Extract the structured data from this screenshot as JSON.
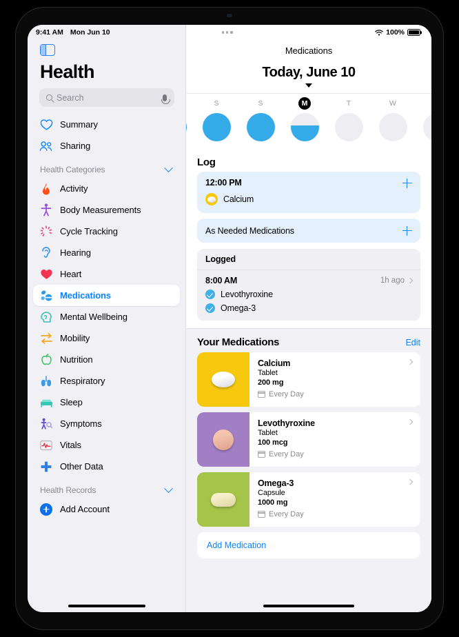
{
  "status_bar": {
    "time": "9:41 AM",
    "date": "Mon Jun 10",
    "battery_percent": "100%",
    "wifi_icon": "wifi-icon",
    "battery_icon": "battery-icon",
    "multitask_icon": "multitask-dots-icon"
  },
  "sidebar": {
    "toggle_icon": "sidebar-toggle-icon",
    "title": "Health",
    "search": {
      "placeholder": "Search",
      "value": "",
      "search_icon": "search-icon",
      "mic_icon": "microphone-icon"
    },
    "top_items": [
      {
        "label": "Summary",
        "icon": "heart-outline-icon",
        "color": "#0a84ff"
      },
      {
        "label": "Sharing",
        "icon": "people-icon",
        "color": "#0a84ff"
      }
    ],
    "sections": [
      {
        "label": "Health Categories",
        "chevron_icon": "chevron-down-icon",
        "items": [
          {
            "label": "Activity",
            "icon": "flame-icon",
            "color": "#ff4d17"
          },
          {
            "label": "Body Measurements",
            "icon": "body-icon",
            "color": "#9b51e0"
          },
          {
            "label": "Cycle Tracking",
            "icon": "cycle-icon",
            "color": "#f0457d"
          },
          {
            "label": "Hearing",
            "icon": "ear-icon",
            "color": "#3b9ae8"
          },
          {
            "label": "Heart",
            "icon": "heart-filled-icon",
            "color": "#f3334f"
          },
          {
            "label": "Medications",
            "icon": "pills-icon",
            "color": "#2f9ae8",
            "selected": true
          },
          {
            "label": "Mental Wellbeing",
            "icon": "head-icon",
            "color": "#38bfb0"
          },
          {
            "label": "Mobility",
            "icon": "arrows-icon",
            "color": "#f5a623"
          },
          {
            "label": "Nutrition",
            "icon": "apple-icon",
            "color": "#3ec46d"
          },
          {
            "label": "Respiratory",
            "icon": "lungs-icon",
            "color": "#3b9ae8"
          },
          {
            "label": "Sleep",
            "icon": "bed-icon",
            "color": "#35c6b5"
          },
          {
            "label": "Symptoms",
            "icon": "symptoms-icon",
            "color": "#5c49d6"
          },
          {
            "label": "Vitals",
            "icon": "vitals-icon",
            "color": "#f3334f"
          },
          {
            "label": "Other Data",
            "icon": "plus-cross-icon",
            "color": "#2f80ed"
          }
        ]
      },
      {
        "label": "Health Records",
        "chevron_icon": "chevron-down-icon",
        "items": [
          {
            "label": "Add Account",
            "icon": "plus-circle-icon",
            "color": "#0a6fe8"
          }
        ]
      }
    ]
  },
  "main": {
    "nav_title": "Medications",
    "today_title": "Today, June 10",
    "caret_icon": "caret-down-icon",
    "week": {
      "days": [
        {
          "letter": "",
          "fill_percent": 100,
          "selected": false,
          "partial": true
        },
        {
          "letter": "S",
          "fill_percent": 100,
          "selected": false
        },
        {
          "letter": "S",
          "fill_percent": 100,
          "selected": false
        },
        {
          "letter": "M",
          "fill_percent": 55,
          "selected": true
        },
        {
          "letter": "T",
          "fill_percent": 0,
          "selected": false
        },
        {
          "letter": "W",
          "fill_percent": 0,
          "selected": false
        },
        {
          "letter": "",
          "fill_percent": 0,
          "selected": false,
          "partial": true
        }
      ]
    },
    "log": {
      "title": "Log",
      "scheduled": {
        "time": "12:00 PM",
        "add_icon": "plus-icon",
        "medications": [
          {
            "name": "Calcium",
            "swatch_color": "#f6c90e",
            "pill_icon": "tablet-icon"
          }
        ]
      },
      "as_needed": {
        "label": "As Needed Medications",
        "add_icon": "plus-icon"
      }
    },
    "logged": {
      "title": "Logged",
      "time": "8:00 AM",
      "ago": "1h ago",
      "chevron_icon": "chevron-right-icon",
      "entries": [
        {
          "name": "Levothyroxine",
          "check_icon": "check-circle-icon"
        },
        {
          "name": "Omega-3",
          "check_icon": "check-circle-icon"
        }
      ]
    },
    "your_medications": {
      "title": "Your Medications",
      "edit_label": "Edit",
      "items": [
        {
          "name": "Calcium",
          "form": "Tablet",
          "dose": "200 mg",
          "frequency": "Every Day",
          "tile_color": "#f6c90e",
          "pill_shape": "oval",
          "calendar_icon": "calendar-icon",
          "chevron_icon": "chevron-right-icon"
        },
        {
          "name": "Levothyroxine",
          "form": "Tablet",
          "dose": "100 mcg",
          "frequency": "Every Day",
          "tile_color": "#a27fc4",
          "pill_shape": "round",
          "calendar_icon": "calendar-icon",
          "chevron_icon": "chevron-right-icon"
        },
        {
          "name": "Omega-3",
          "form": "Capsule",
          "dose": "1000 mg",
          "frequency": "Every Day",
          "tile_color": "#a5c44a",
          "pill_shape": "capsule",
          "calendar_icon": "calendar-icon",
          "chevron_icon": "chevron-right-icon"
        }
      ],
      "add_label": "Add Medication"
    }
  },
  "colors": {
    "accent_blue": "#0a84ff",
    "ring_blue": "#34aae8",
    "log_card_bg": "#e4f0fb",
    "sidebar_bg": "#f1f1f5"
  }
}
